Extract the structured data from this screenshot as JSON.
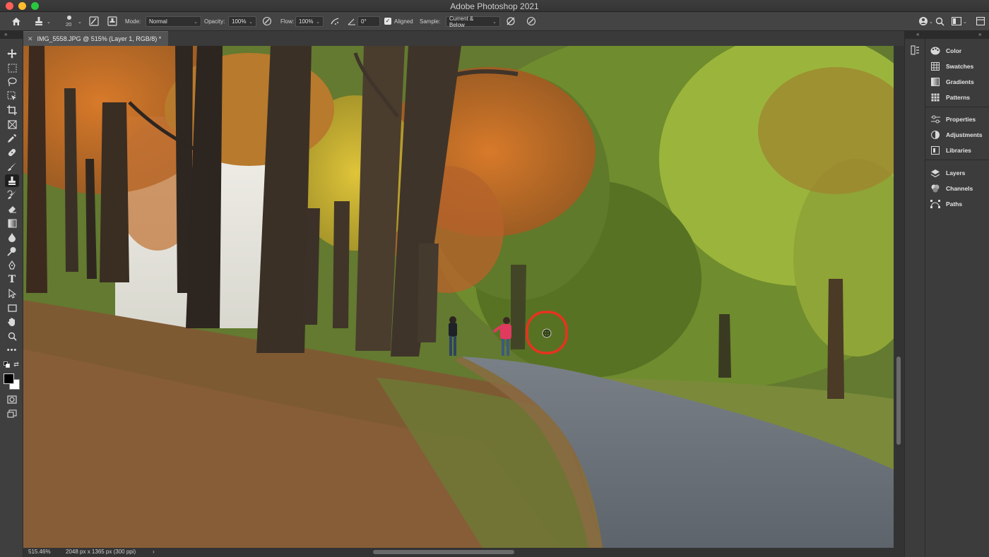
{
  "window": {
    "title": "Adobe Photoshop 2021"
  },
  "options_bar": {
    "brush_size": "20",
    "mode_label": "Mode:",
    "mode_value": "Normal",
    "opacity_label": "Opacity:",
    "opacity_value": "100%",
    "flow_label": "Flow:",
    "flow_value": "100%",
    "angle_value": "0°",
    "aligned_label": "Aligned",
    "aligned_checked": true,
    "sample_label": "Sample:",
    "sample_value": "Current & Below"
  },
  "document": {
    "tab_title": "IMG_5558.JPG @ 515% (Layer 1, RGB/8) *"
  },
  "status": {
    "zoom": "515.46%",
    "doc_info": "2048 px x 1365 px (300 ppi)",
    "arrow": "›"
  },
  "panels": {
    "group1": [
      "Color",
      "Swatches",
      "Gradients",
      "Patterns"
    ],
    "group2": [
      "Properties",
      "Adjustments",
      "Libraries"
    ],
    "group3": [
      "Layers",
      "Channels",
      "Paths"
    ]
  },
  "colors": {
    "foreground": "#000000",
    "background": "#ffffff",
    "highlight_ring": "#e8321f"
  }
}
